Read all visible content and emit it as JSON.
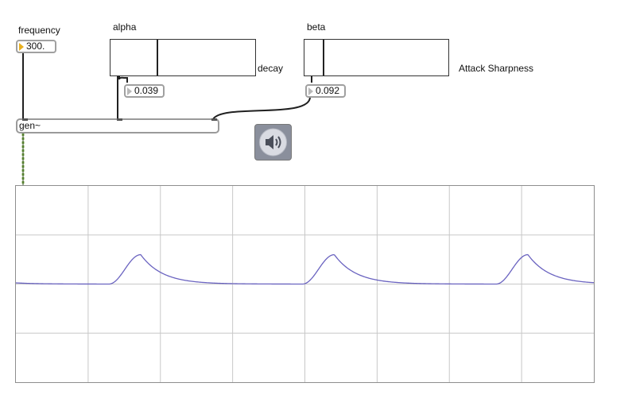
{
  "labels": {
    "frequency": "frequency",
    "alpha": "alpha",
    "beta": "beta",
    "decay": "decay",
    "attack": "Attack Sharpness"
  },
  "numboxes": {
    "frequency": "300.",
    "decay": "0.039",
    "attack": "0.092"
  },
  "sliders": {
    "alpha": 0.32,
    "beta": 0.13
  },
  "gen_object": {
    "text": "gen~"
  },
  "audio_toggle": {
    "icon": "speaker-icon",
    "state": "off"
  },
  "scope": {
    "grid_cols": 8,
    "grid_rows": 4,
    "trace_color": "#6a63c0",
    "grid_color": "#c8c8c8",
    "cycles": 3
  },
  "colors": {
    "signal_patchcord": "#8ab85a",
    "patchcord": "#202020",
    "numbox_active_arrow": "#e8b020"
  }
}
